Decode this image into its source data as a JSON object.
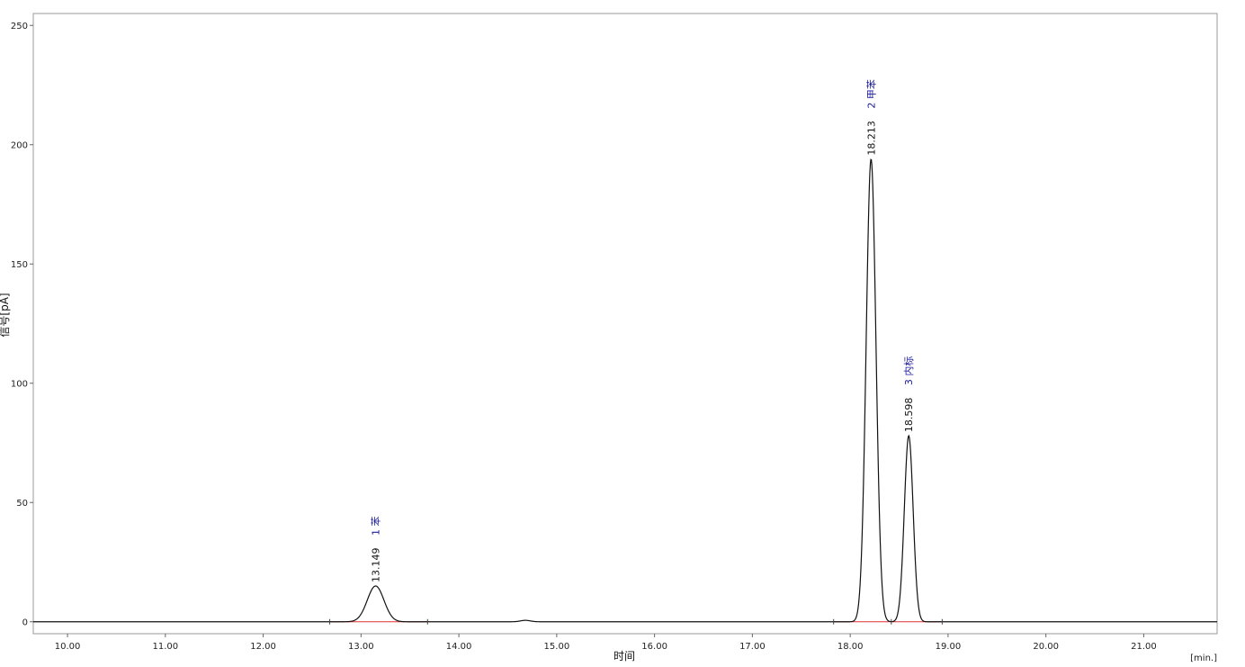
{
  "chart_data": {
    "type": "line",
    "xlabel": "时间",
    "ylabel": "信号[pA]",
    "x_unit_label": "[min.]",
    "xlim": [
      9.65,
      21.75
    ],
    "ylim": [
      -5,
      255
    ],
    "xticks": [
      "10.00",
      "11.00",
      "12.00",
      "13.00",
      "14.00",
      "15.00",
      "16.00",
      "17.00",
      "18.00",
      "19.00",
      "20.00",
      "21.00"
    ],
    "yticks": [
      "0",
      "50",
      "100",
      "150",
      "200",
      "250"
    ],
    "baseline": 0,
    "grid": false,
    "colors": {
      "signal": "#111111",
      "baseline": "#e03030",
      "peak_name": "#1a1a9c",
      "frame": "#999999"
    },
    "peaks": [
      {
        "rt": 13.149,
        "rt_label": "13.149",
        "number": "1",
        "name": "苯",
        "height": 15,
        "sigma": 0.085
      },
      {
        "rt": 18.213,
        "rt_label": "18.213",
        "number": "2",
        "name": "甲苯",
        "height": 194,
        "sigma": 0.05
      },
      {
        "rt": 18.598,
        "rt_label": "18.598",
        "number": "3",
        "name": "内标",
        "height": 78,
        "sigma": 0.045
      }
    ],
    "minor_bumps": [
      {
        "rt": 14.68,
        "height": 0.6,
        "sigma": 0.05
      }
    ],
    "integration_marks": [
      12.68,
      13.68,
      17.83,
      18.42,
      18.94
    ]
  }
}
